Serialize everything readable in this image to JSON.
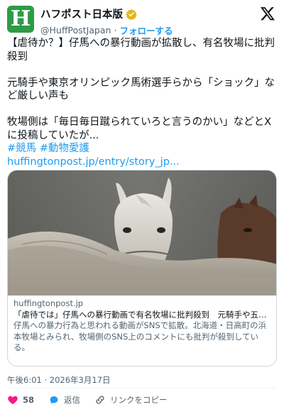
{
  "account": {
    "display_name": "ハフポスト日本版",
    "handle": "@HuffPostJapan",
    "separator": "·",
    "follow_label": "フォローする",
    "avatar_letter": "H",
    "avatar_color": "#2e9b47",
    "badge_color": "#e2b719",
    "avatar_icon": "huffpost-logo"
  },
  "tweet": {
    "paragraphs": [
      "【虐待か？】仔馬への暴行動画が拡散し、有名牧場に批判殺到",
      "元騎手や東京オリンピック馬術選手らから「ショック」など厳しい声も",
      "牧場側は「毎日毎日蹴られていろと言うのかい」などとXに投稿していたが..."
    ],
    "hashtags": [
      "#競馬",
      "#動物愛護"
    ],
    "link": "huffingtonpost.jp/entry/story_jp..."
  },
  "card": {
    "image_desc_icon": "horses-photo",
    "domain": "huffingtonpost.jp",
    "title": "「虐待では」仔馬への暴行動画で有名牧場に批判殺到　元騎手や五輪...",
    "description": "仔馬への暴力行為と思われる動画がSNSで拡散。北海道・日高町の浜本牧場とみられ、牧場側のSNS上のコメントにも批判が殺到している。"
  },
  "timestamp": "午後6:01 · 2026年3月17日",
  "actions": {
    "likes": "58",
    "reply_label": "返信",
    "copy_link_label": "リンクをコピー"
  },
  "colors": {
    "accent": "#1d9bf0",
    "like": "#f91880",
    "text": "#0f1419",
    "muted": "#536471"
  }
}
